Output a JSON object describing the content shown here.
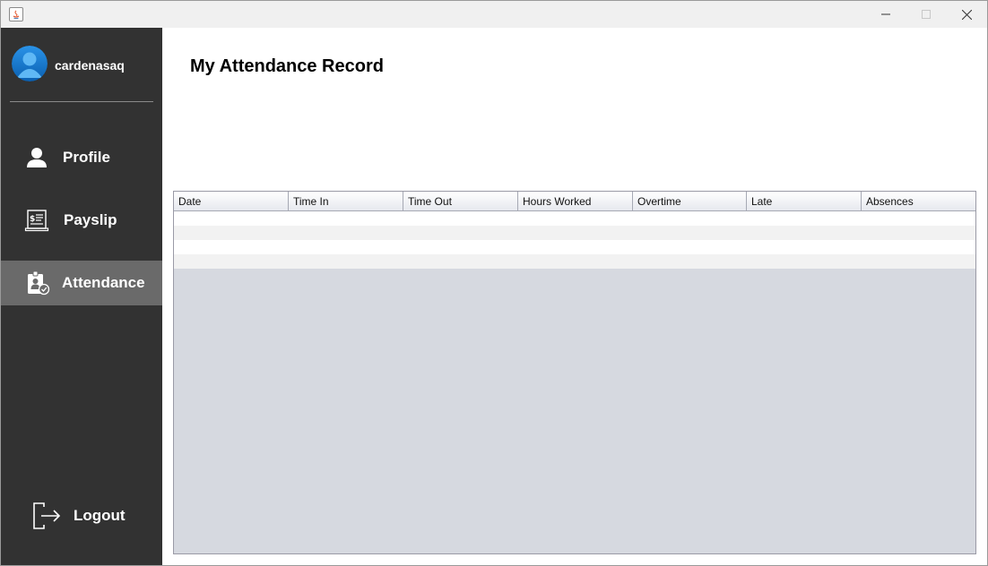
{
  "window": {
    "title": ""
  },
  "user": {
    "username": "cardenasaq"
  },
  "nav": {
    "items": [
      {
        "label": "Profile",
        "icon": "user-icon"
      },
      {
        "label": "Payslip",
        "icon": "payslip-icon"
      },
      {
        "label": "Attendance",
        "icon": "attendance-icon",
        "active": true
      }
    ],
    "logout_label": "Logout"
  },
  "main": {
    "title": "My Attendance Record"
  },
  "table": {
    "columns": [
      "Date",
      "Time In",
      "Time Out",
      "Hours Worked",
      "Overtime",
      "Late",
      "Absences"
    ],
    "rows": []
  },
  "colors": {
    "sidebar": "#323232",
    "active_item": "#6a6a6a",
    "table_empty_area": "#d6d9e0",
    "avatar_blue": "#1a7fd4"
  }
}
